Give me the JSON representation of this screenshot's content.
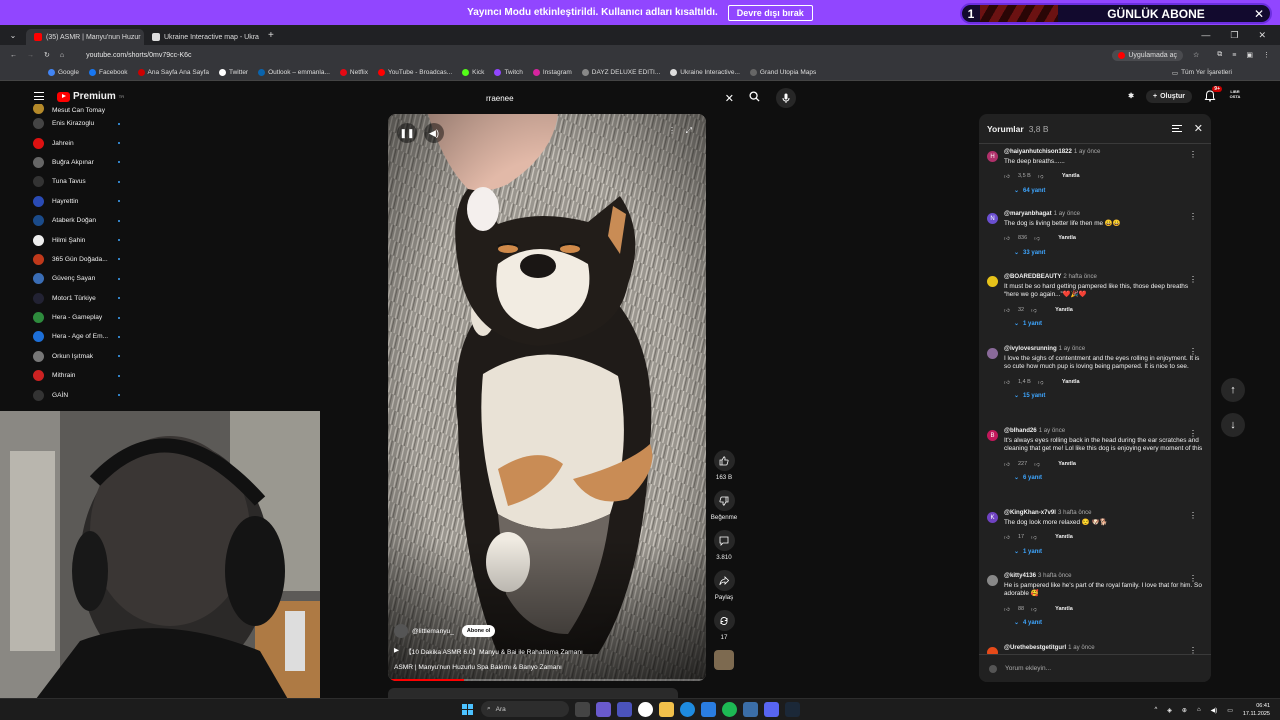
{
  "banner": {
    "text": "Yayıncı Modu etkinleştirildi. Kullanıcı adları kısaltıldı.",
    "button": "Devre dışı bırak"
  },
  "sub_widget": {
    "number": "1",
    "label": "GÜNLÜK ABONE",
    "close": "✕"
  },
  "browser": {
    "tabs": [
      {
        "label": "(35) ASMR | Manyu'nun Huzur"
      },
      {
        "label": "Ukraine Interactive map - Ukra"
      }
    ],
    "new_tab": "+",
    "url": "youtube.com/shorts/0mv79cc-K6c",
    "open_in_app": "Uygulamada aç",
    "bookmarks": [
      "Google",
      "Facebook",
      "Ana Sayfa Ana Sayfa",
      "Twitter",
      "Outlook – emmanla...",
      "Netflix",
      "YouTube - Broadcas...",
      "Kick",
      "Twitch",
      "Instagram",
      "DAYZ DELUXE EDITI...",
      "Ukraine Interactive...",
      "Grand Utopia Maps"
    ],
    "all_bookmarks": "Tüm Yer İşaretleri"
  },
  "youtube": {
    "logo": "Premium",
    "logo_region": "TR",
    "search_query": "rraenee",
    "create_label": "Oluştur",
    "notif_badge": "9+",
    "channel_logo": "LIBR OSTA"
  },
  "sidebar": {
    "partial_top": "Mesut Can Tomay",
    "items": [
      {
        "label": "Enis Kirazoglu",
        "color": "#444"
      },
      {
        "label": "Jahrein",
        "color": "#d11"
      },
      {
        "label": "Buğra Akpınar",
        "color": "#666"
      },
      {
        "label": "Tuna Tavus",
        "color": "#333"
      },
      {
        "label": "Hayrettin",
        "color": "#2a4bb5"
      },
      {
        "label": "Ataberk Doğan",
        "color": "#1b4b8a"
      },
      {
        "label": "Hilmi Şahin",
        "color": "#eee"
      },
      {
        "label": "365 Gün Doğada...",
        "color": "#c0391b"
      },
      {
        "label": "Güvenç Sayan",
        "color": "#3a6db5"
      },
      {
        "label": "Motor1 Türkiye",
        "color": "#223"
      },
      {
        "label": "Hera - Gameplay",
        "color": "#2e8b3d"
      },
      {
        "label": "Hera - Age of Em...",
        "color": "#1d6fd8"
      },
      {
        "label": "Orkun Işıtmak",
        "color": "#777"
      },
      {
        "label": "Mithrain",
        "color": "#c22"
      },
      {
        "label": "GAİN",
        "color": "#333"
      }
    ]
  },
  "video": {
    "channel": "@littlemanyu_",
    "subscribe": "Abone ol",
    "title1": "【10 Dakika ASMR 6.0】Manyu & Bai ile Rahatlama Zamanı",
    "title2": "ASMR | Manyu'nun Huzurlu Spa Bakımı & Banyo Zamanı",
    "progress": 0.24
  },
  "rail": {
    "likes": "163 B",
    "dislike": "Beğenme",
    "comments": "3.810",
    "share": "Paylaş",
    "remix": "17"
  },
  "comments": {
    "title": "Yorumlar",
    "count": "3,8 B",
    "placeholder": "Yorum ekleyin...",
    "items": [
      {
        "user": "@haiyanhutchison1822",
        "age": "1 ay önce",
        "text": "The deep breaths......",
        "likes": "3,5 B",
        "replies": "64 yanıt",
        "avatar": "H",
        "color": "#b0306a"
      },
      {
        "user": "@maryanbhagat",
        "age": "1 ay önce",
        "text": "The dog is living better life then me 😀😀",
        "likes": "836",
        "replies": "33 yanıt",
        "avatar": "N",
        "color": "#6a4fd0"
      },
      {
        "user": "@BOAREDBEAUTY",
        "age": "2 hafta önce",
        "text": "It must be so hard getting pampered like this, those deep breaths “here we go again...”❤️🎉❤️",
        "likes": "32",
        "replies": "1 yanıt",
        "avatar": "",
        "color": "#e6c21a"
      },
      {
        "user": "@ivylovesrunning",
        "age": "1 ay önce",
        "text": "I love the sighs of contentment and the eyes rolling in enjoyment. It is so cute how much pup is loving being pampered. It is nice to see.",
        "likes": "1,4 B",
        "replies": "15 yanıt",
        "avatar": "",
        "color": "#8a6a9a"
      },
      {
        "user": "@blhand26",
        "age": "1 ay önce",
        "text": "It's always eyes rolling back in the head during the ear scratches and cleaning that get me! Lol like this dog is enjoying every moment of this",
        "likes": "227",
        "replies": "6 yanıt",
        "avatar": "B",
        "color": "#c2185b"
      },
      {
        "user": "@KingKhan-x7v9l",
        "age": "3 hafta önce",
        "text": "The dog look more relaxed 😌 🐶🐕",
        "likes": "17",
        "replies": "1 yanıt",
        "avatar": "K",
        "color": "#6f42c1"
      },
      {
        "user": "@kitty4136",
        "age": "3 hafta önce",
        "text": "He is pampered like he's part of the royal family. I love that for him. So adorable 🥰",
        "likes": "88",
        "replies": "4 yanıt",
        "avatar": "",
        "color": "#888"
      },
      {
        "user": "@Urethebestgetitgurl",
        "age": "1 ay önce",
        "text": "",
        "likes": "",
        "replies": "",
        "avatar": "",
        "color": "#e64a19"
      }
    ],
    "reply_label": "Yanıtla"
  },
  "taskbar": {
    "search": "Ara",
    "time": "06:41",
    "date": "17.11.2025"
  }
}
